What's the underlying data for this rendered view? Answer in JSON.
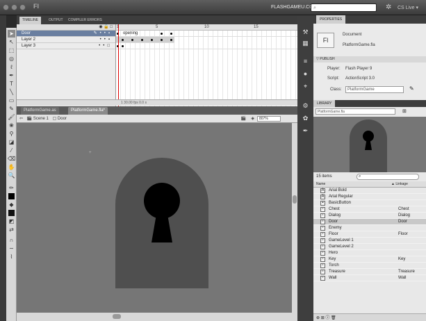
{
  "window": {
    "app_logo": "Fl",
    "workspace": "FLASHGAMEU.COM ▾",
    "search_placeholder": "",
    "cs_live": "CS Live ▾"
  },
  "panel_tabs": [
    "TIMELINE",
    "OUTPUT",
    "COMPILER ERRORS"
  ],
  "timeline": {
    "layers": [
      {
        "name": "Door",
        "active": true
      },
      {
        "name": "Layer 2",
        "active": false
      },
      {
        "name": "Layer 3",
        "active": false
      }
    ],
    "header_icons": "◉ 🔒 □",
    "frame_numbers": [
      "1",
      "5",
      "10",
      "15"
    ],
    "frame_label": "opening",
    "footer": "1   30.00 fps  0.0 s"
  },
  "document_tabs": [
    "PlatformGame.as",
    "PlatformGame.fla*"
  ],
  "edit_bar": {
    "scene": "Scene 1",
    "symbol": "Door",
    "zoom": "807%"
  },
  "properties": {
    "tab": "PROPERTIES",
    "type": "Document",
    "icon": "Fl",
    "filename": "PlatformGame.fla",
    "section": "PUBLISH",
    "player_label": "Player:",
    "player": "Flash Player 9",
    "script_label": "Script:",
    "script": "ActionScript 3.0",
    "class_label": "Class:",
    "class_value": "PlatformGame"
  },
  "library": {
    "tab": "LIBRARY",
    "file": "PlatformGame.fla",
    "item_count": "15 items",
    "col_name": "Name",
    "col_linkage": "▲ Linkage",
    "items": [
      {
        "name": "Arial Bold",
        "linkage": "",
        "icon": "A"
      },
      {
        "name": "Arial Regular",
        "linkage": "",
        "icon": "A"
      },
      {
        "name": "BasicButton",
        "linkage": "",
        "icon": "▪"
      },
      {
        "name": "Chest",
        "linkage": "Chest",
        "icon": "▫"
      },
      {
        "name": "Dialog",
        "linkage": "Dialog",
        "icon": "▫"
      },
      {
        "name": "Door",
        "linkage": "Door",
        "icon": "▫"
      },
      {
        "name": "Enemy",
        "linkage": "",
        "icon": "▫"
      },
      {
        "name": "Floor",
        "linkage": "Floor",
        "icon": "▫"
      },
      {
        "name": "GameLevel 1",
        "linkage": "",
        "icon": "▫"
      },
      {
        "name": "GameLevel 2",
        "linkage": "",
        "icon": "▫"
      },
      {
        "name": "Hero",
        "linkage": "",
        "icon": "▫"
      },
      {
        "name": "Key",
        "linkage": "Key",
        "icon": "▫"
      },
      {
        "name": "Torch",
        "linkage": "",
        "icon": "▫"
      },
      {
        "name": "Treasure",
        "linkage": "Treasure",
        "icon": "▫"
      },
      {
        "name": "Wall",
        "linkage": "Wall",
        "icon": "▫"
      }
    ],
    "selected": "Door"
  },
  "colors": {
    "stage": "#767676",
    "door": "#4f4f4f",
    "keyhole": "#000000",
    "selected_layer": "#6a7fa0"
  }
}
